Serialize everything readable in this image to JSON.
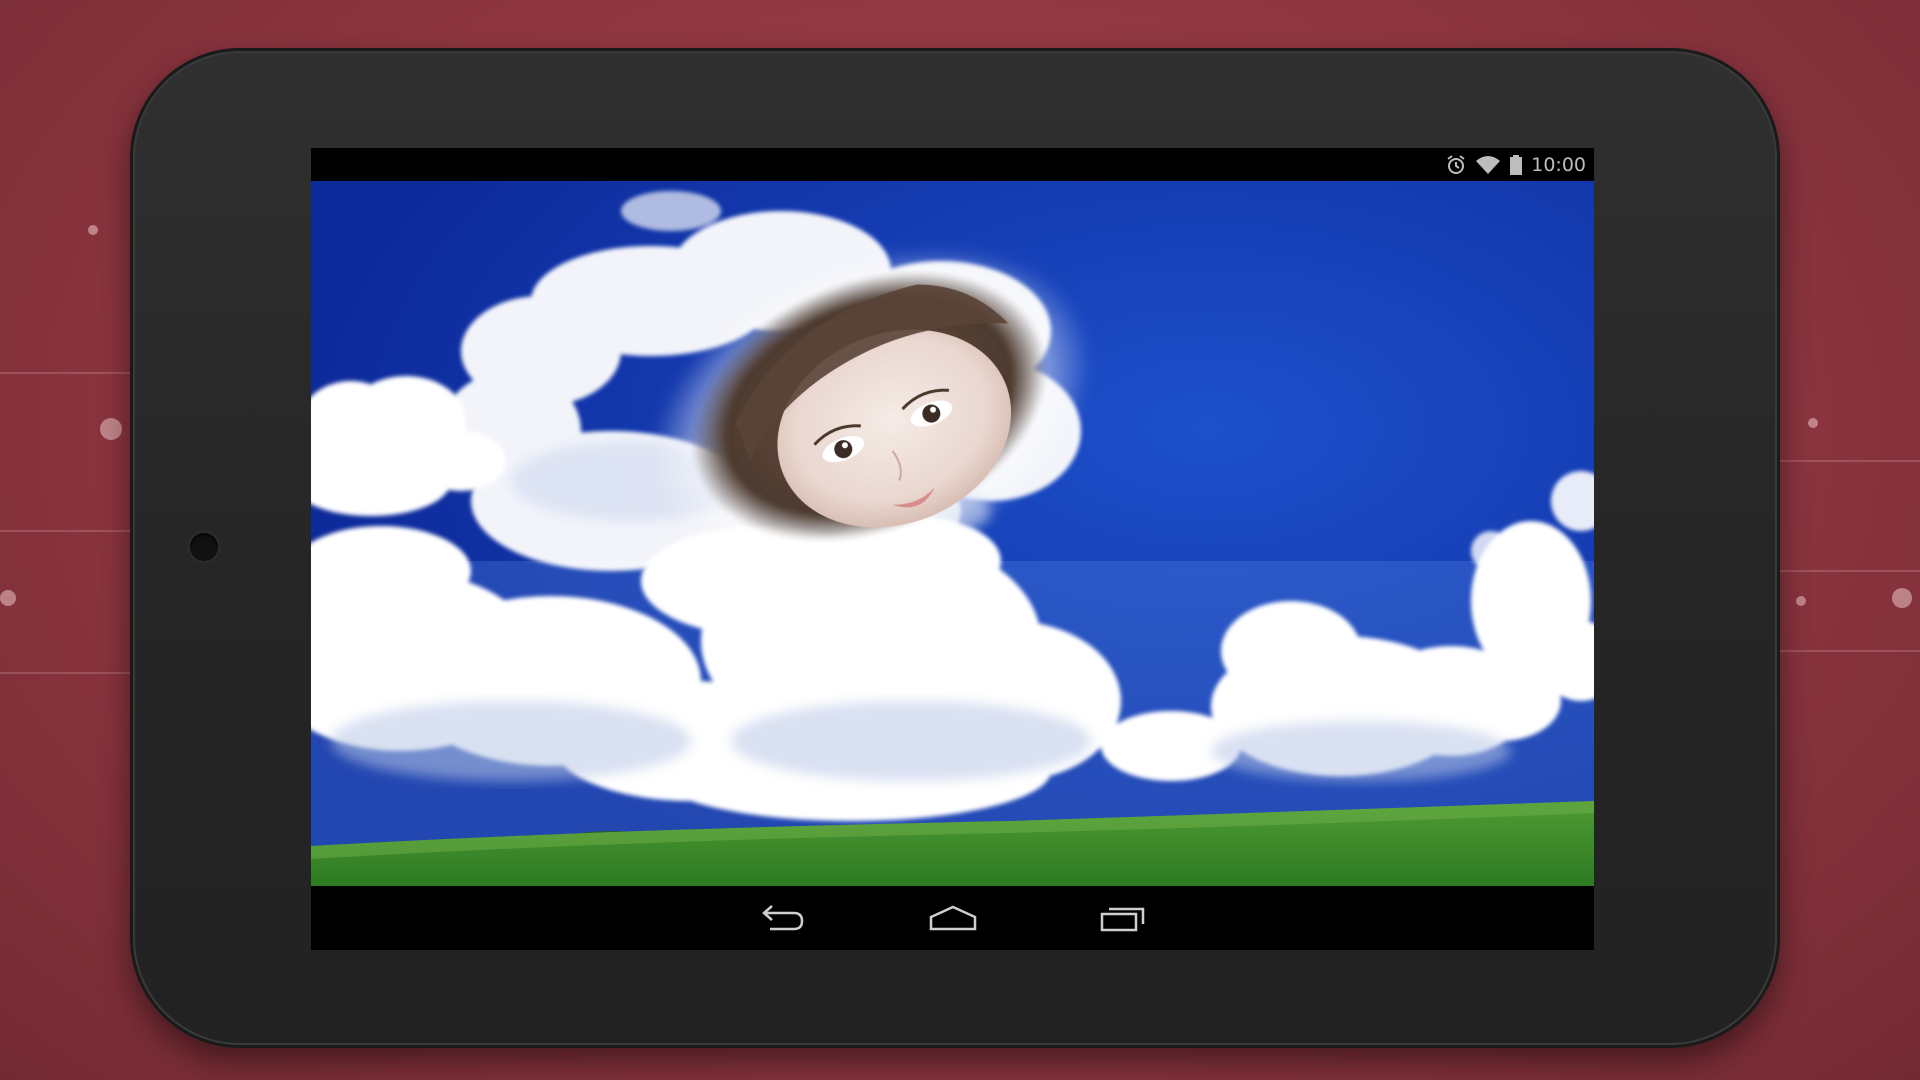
{
  "status_bar": {
    "time": "10:00",
    "icons": [
      "alarm-icon",
      "wifi-icon",
      "battery-icon"
    ]
  },
  "nav_bar": {
    "buttons": [
      "back-icon",
      "home-icon",
      "recent-apps-icon"
    ]
  },
  "colors": {
    "background": "#8e3640",
    "device_body": "#262626",
    "sky": "#1a4ac2",
    "grass": "#3f8f2c"
  }
}
